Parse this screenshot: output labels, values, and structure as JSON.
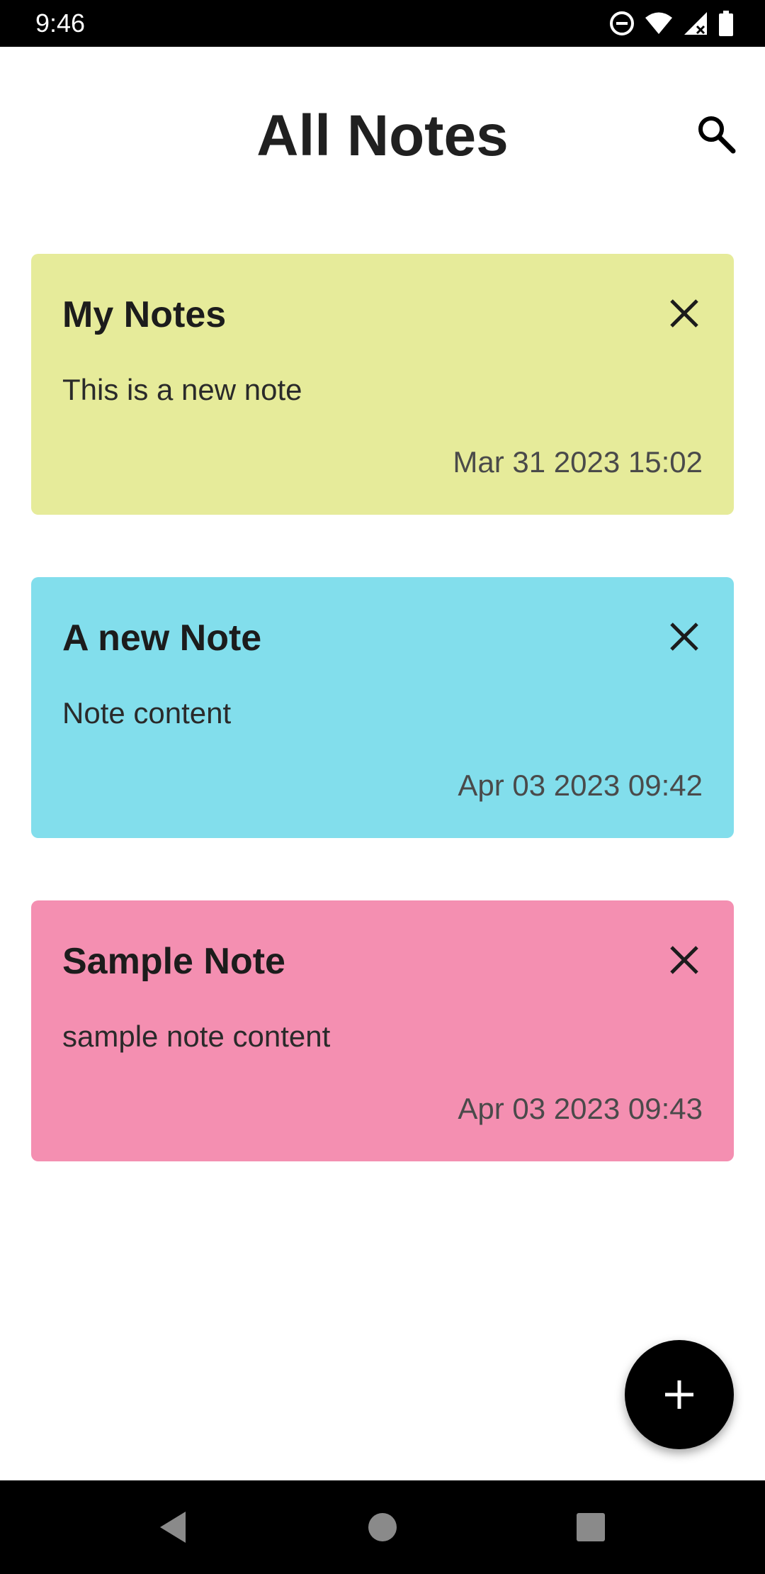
{
  "status_bar": {
    "time": "9:46",
    "icons": [
      "do-not-disturb-icon",
      "wifi-icon",
      "cellular-signal-icon",
      "battery-icon"
    ]
  },
  "header": {
    "title": "All Notes",
    "search_icon": "search-icon"
  },
  "notes": [
    {
      "title": "My Notes",
      "content": "This is a new note",
      "date": "Mar 31 2023 15:02",
      "color": "#e6eb9a"
    },
    {
      "title": "A new Note",
      "content": "Note content",
      "date": "Apr 03 2023 09:42",
      "color": "#82deec"
    },
    {
      "title": "Sample Note",
      "content": "sample note content",
      "date": "Apr 03 2023 09:43",
      "color": "#f48fb1"
    }
  ],
  "fab": {
    "icon": "plus-icon",
    "color": "#000000"
  },
  "nav_bar": {
    "icons": [
      "back-icon",
      "home-icon",
      "recents-icon"
    ]
  }
}
